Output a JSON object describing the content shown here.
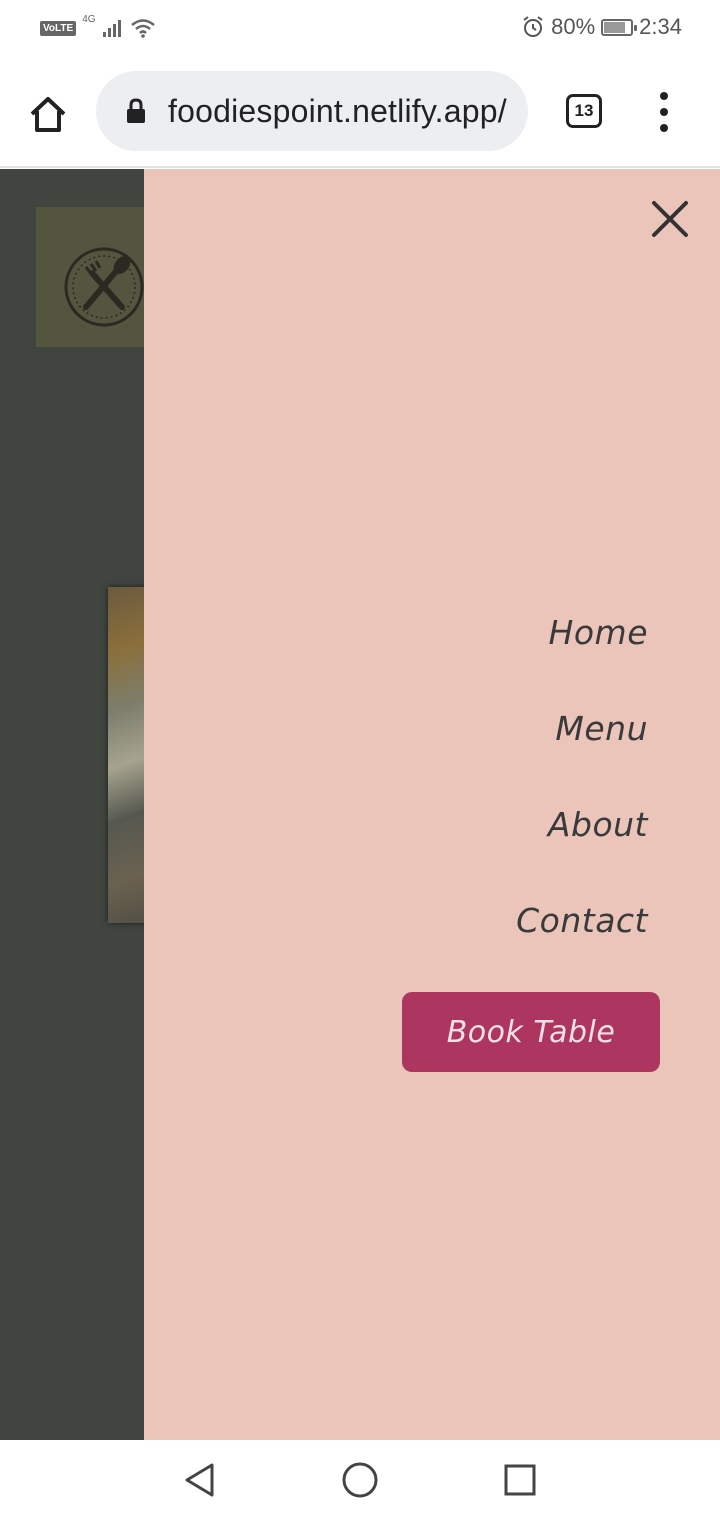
{
  "status_bar": {
    "volte": "VoLTE",
    "network": "4G",
    "battery_percent": "80%",
    "battery_level": 0.8,
    "time": "2:34"
  },
  "browser": {
    "url": "foodiespoint.netlify.app/",
    "tab_count": "13"
  },
  "drawer": {
    "nav_items": [
      "Home",
      "Menu",
      "About",
      "Contact"
    ],
    "cta_label": "Book Table",
    "background": "#ebc5b9",
    "cta_color": "#ac365f"
  },
  "icons": {
    "browser_home": "home-icon",
    "lock": "lock-icon",
    "overflow": "more-vert-icon",
    "close": "close-icon",
    "back": "back-triangle-icon",
    "home": "home-circle-icon",
    "recents": "recents-square-icon"
  }
}
